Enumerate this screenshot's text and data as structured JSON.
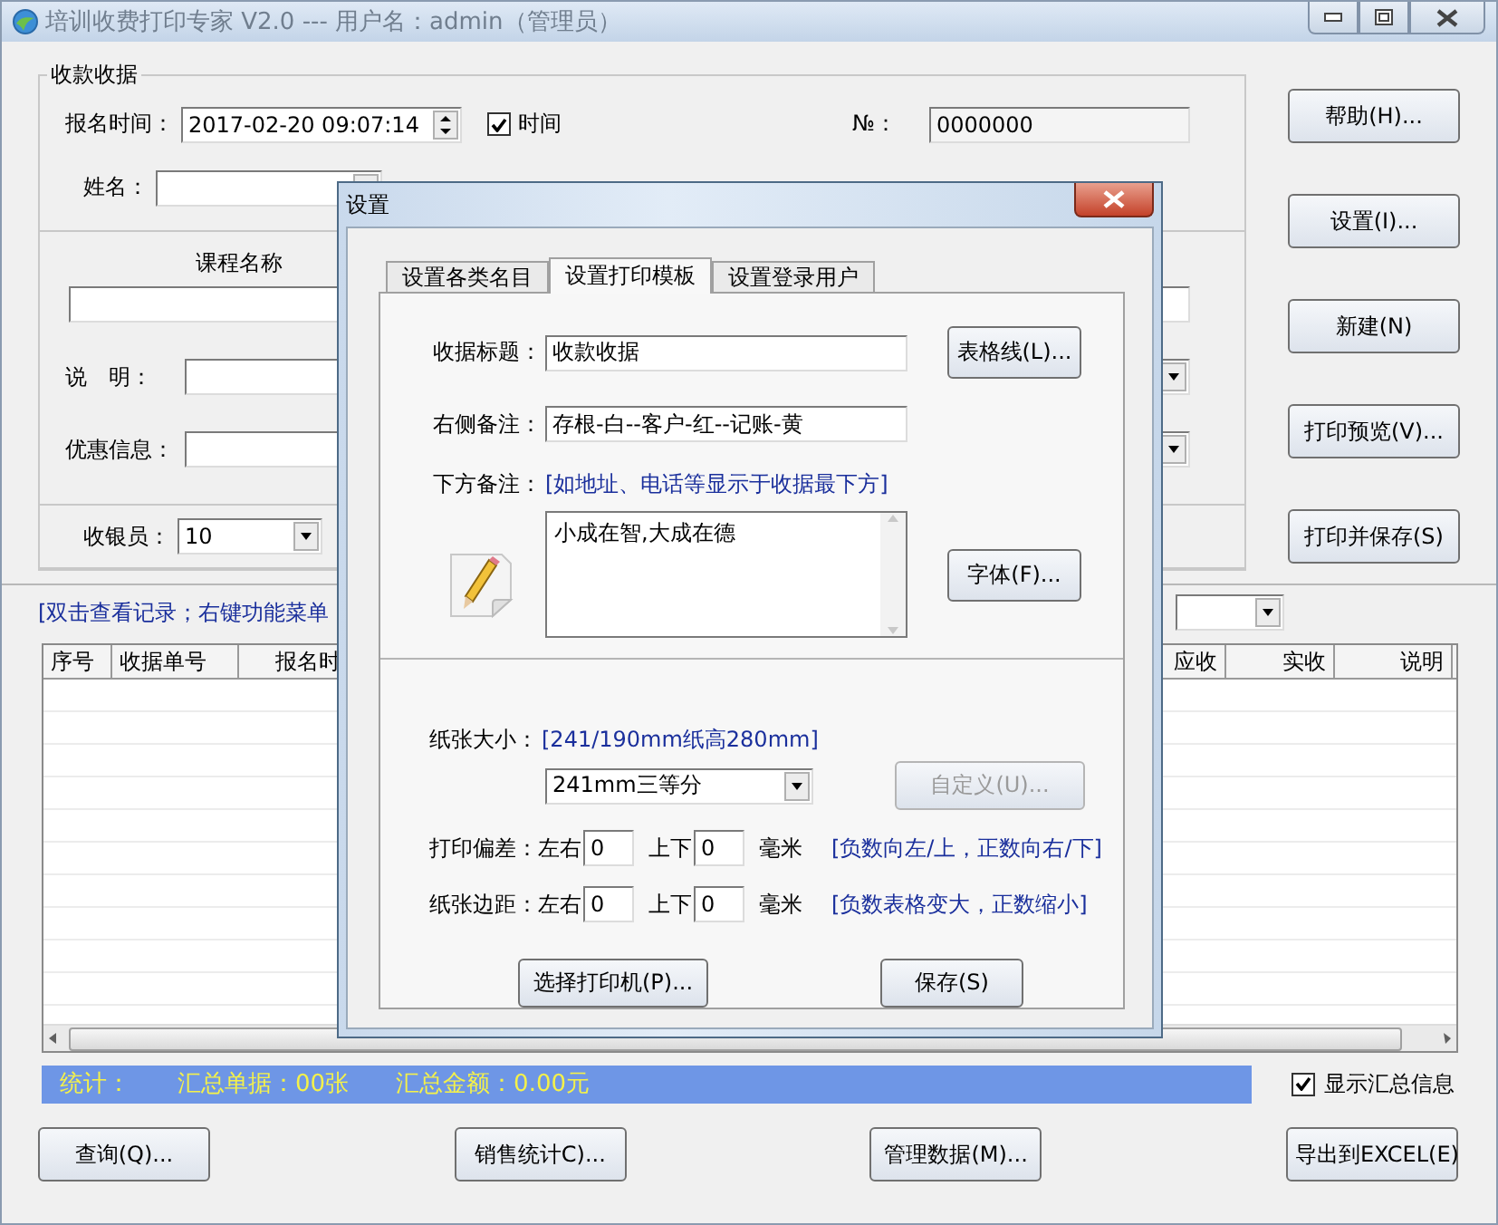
{
  "window": {
    "title": "培训收费打印专家 V2.0 --- 用户名：admin（管理员）"
  },
  "receipt": {
    "title": "收款收据",
    "time_label": "报名时间：",
    "time_value": "2017-02-20 09:07:14",
    "time_checkbox": {
      "label": "时间",
      "checked": true
    },
    "no_label": "№：",
    "no_value": "0000000",
    "name_label": "姓名：",
    "course_heading": "课程名称",
    "note_label": "说　明：",
    "discount_label": "优惠信息：",
    "cashier_label": "收银员：",
    "cashier_value": "10"
  },
  "side_buttons": [
    "帮助(H)...",
    "设置(I)...",
    "新建(N)",
    "打印预览(V)...",
    "打印并保存(S)"
  ],
  "list_hint": "[双击查看记录；右键功能菜单",
  "table": {
    "columns": [
      {
        "label": "序号",
        "kind": "left"
      },
      {
        "label": "收据单号",
        "kind": "left"
      },
      {
        "label": "报名时",
        "kind": "left"
      },
      {
        "label": "应收",
        "kind": "right"
      },
      {
        "label": "实收",
        "kind": "right"
      },
      {
        "label": "说明",
        "kind": "right"
      }
    ]
  },
  "summary": {
    "items": [
      "统计：",
      "汇总单据：00张",
      "汇总金额：0.00元"
    ],
    "show_checkbox": {
      "label": "显示汇总信息",
      "checked": true
    }
  },
  "bottom_buttons": [
    "查询(Q)...",
    "销售统计C)...",
    "管理数据(M)...",
    "导出到EXCEL(E)"
  ],
  "dialog": {
    "title": "设置",
    "tabs": [
      {
        "label": "设置各类名目",
        "selected": false
      },
      {
        "label": "设置打印模板",
        "selected": true
      },
      {
        "label": "设置登录用户",
        "selected": false
      }
    ],
    "title_field": {
      "label": "收据标题：",
      "value": "收款收据"
    },
    "side_note_field": {
      "label": "右侧备注：",
      "value": "存根-白--客户-红--记账-黄"
    },
    "bottom_note": {
      "label": "下方备注：",
      "hint": "[如地址、电话等显示于收据最下方]",
      "value": "小成在智,大成在德"
    },
    "paper_size": {
      "label": "纸张大小：",
      "hint": "[241/190mm纸高280mm]",
      "value": "241mm三等分"
    },
    "offset_rows": [
      {
        "label": "打印偏差：左右",
        "lr_value": "0",
        "ud_label": "上下",
        "ud_value": "0",
        "unit": "毫米",
        "hint": "[负数向左/上，正数向右/下]"
      },
      {
        "label": "纸张边距：左右",
        "lr_value": "0",
        "ud_label": "上下",
        "ud_value": "0",
        "unit": "毫米",
        "hint": "[负数表格变大，正数缩小]"
      }
    ],
    "buttons": [
      {
        "label": "表格线(L)...",
        "disabled": false
      },
      {
        "label": "字体(F)...",
        "disabled": false
      },
      {
        "label": "自定义(U)...",
        "disabled": true
      },
      {
        "label": "选择打印机(P)...",
        "disabled": false
      },
      {
        "label": "保存(S)",
        "disabled": false
      }
    ]
  }
}
